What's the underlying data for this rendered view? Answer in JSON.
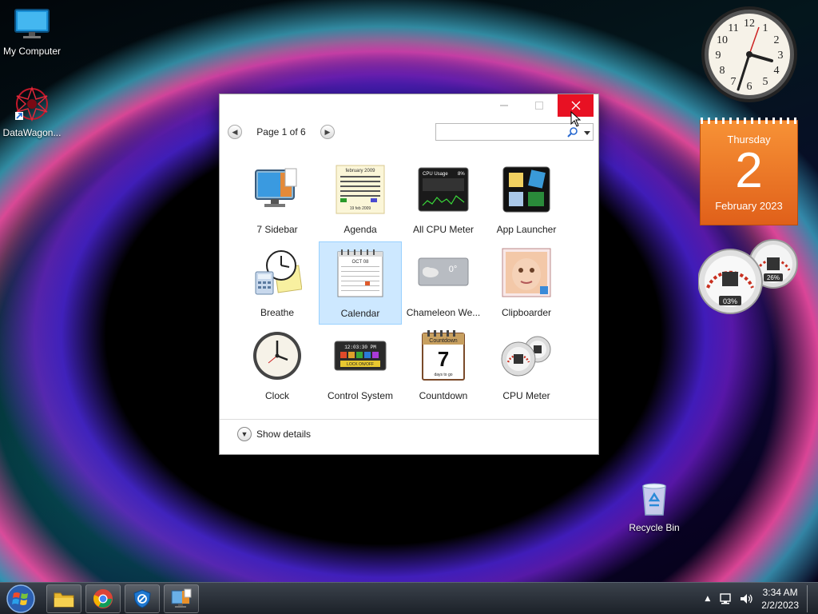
{
  "desktop": {
    "icons": [
      {
        "label": "My Computer"
      },
      {
        "label": "DataWagon..."
      },
      {
        "label": "Recycle Bin"
      }
    ]
  },
  "window": {
    "pager_text": "Page 1 of 6",
    "search_placeholder": "",
    "gadgets": [
      {
        "name": "7 Sidebar"
      },
      {
        "name": "Agenda"
      },
      {
        "name": "All CPU Meter"
      },
      {
        "name": "App Launcher"
      },
      {
        "name": "Breathe"
      },
      {
        "name": "Calendar",
        "selected": true
      },
      {
        "name": "Chameleon We..."
      },
      {
        "name": "Clipboarder"
      },
      {
        "name": "Clock"
      },
      {
        "name": "Control System"
      },
      {
        "name": "Countdown"
      },
      {
        "name": "CPU Meter"
      }
    ],
    "details_label": "Show details",
    "thumb_text": {
      "agenda_title": "february 2009",
      "agenda_footer": "19 feb 2009",
      "cpu_title": "CPU Usage",
      "cpu_percent": "8%",
      "calendar_month": "OCT 08",
      "chameleon_temp": "0°",
      "control_time": "12:03:30 PM",
      "control_lock": "LOCK ON/OFF",
      "countdown_title": "Countdown",
      "countdown_number": "7",
      "countdown_footer": "days to go"
    }
  },
  "calendar_gadget": {
    "weekday": "Thursday",
    "day": "2",
    "month_year": "February 2023"
  },
  "cpu_gadget": {
    "cpu_percent": "03%",
    "ram_percent": "26%"
  },
  "taskbar": {
    "time": "3:34 AM",
    "date": "2/2/2023"
  },
  "colors": {
    "close_red": "#e81123",
    "calendar_orange": "#f08030",
    "selection_blue": "#cde8ff"
  }
}
